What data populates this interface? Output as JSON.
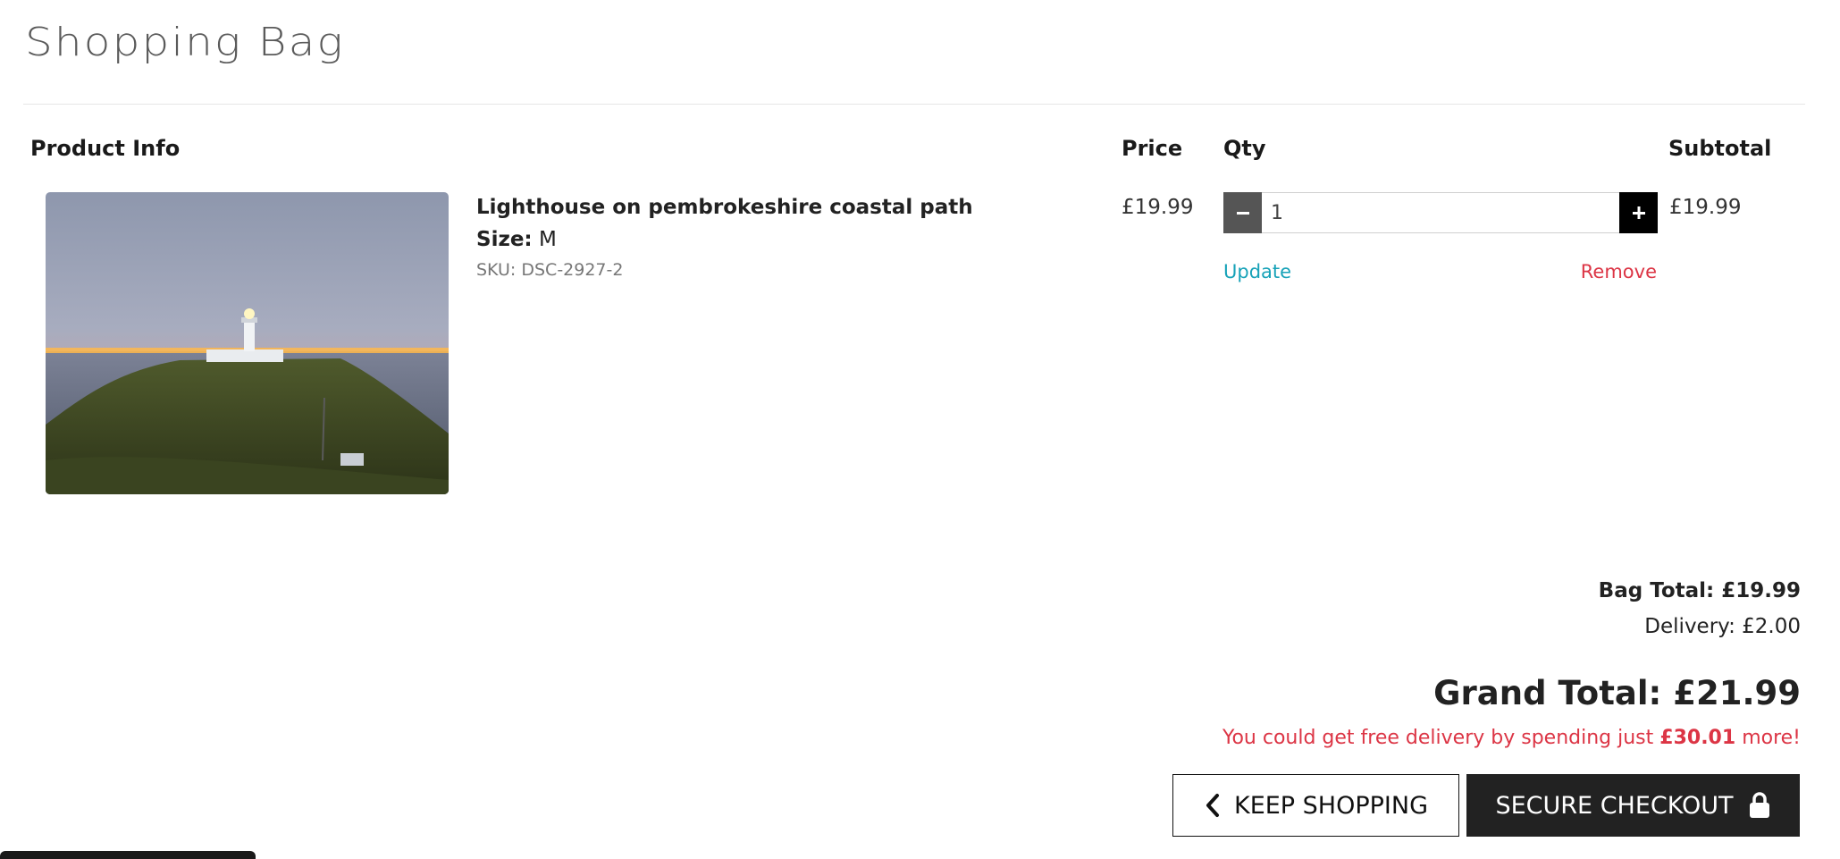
{
  "page": {
    "title": "Shopping Bag"
  },
  "table": {
    "headers": {
      "product": "Product Info",
      "price": "Price",
      "qty": "Qty",
      "subtotal": "Subtotal"
    }
  },
  "items": [
    {
      "name": "Lighthouse on pembrokeshire coastal path",
      "size_label": "Size:",
      "size_value": "M",
      "sku": "SKU: DSC-2927-2",
      "price": "£19.99",
      "quantity": "1",
      "subtotal": "£19.99",
      "update_label": "Update",
      "remove_label": "Remove"
    }
  ],
  "summary": {
    "bag_total": "Bag Total: £19.99",
    "delivery": "Delivery: £2.00",
    "grand_total": "Grand Total: £21.99",
    "free_delivery_prefix": "You could get free delivery by spending just",
    "free_delivery_amount": "£30.01",
    "free_delivery_suffix": "more!"
  },
  "actions": {
    "keep_shopping": "KEEP SHOPPING",
    "secure_checkout": "SECURE CHECKOUT"
  },
  "icons": {
    "qty_minus": "minus-icon",
    "qty_plus": "plus-icon",
    "keep_shopping": "chevron-left-icon",
    "secure_checkout": "lock-icon"
  },
  "colors": {
    "update": "#17a2b8",
    "remove": "#dc3545",
    "free_delivery": "#dc3545",
    "checkout_bg": "#222222"
  }
}
